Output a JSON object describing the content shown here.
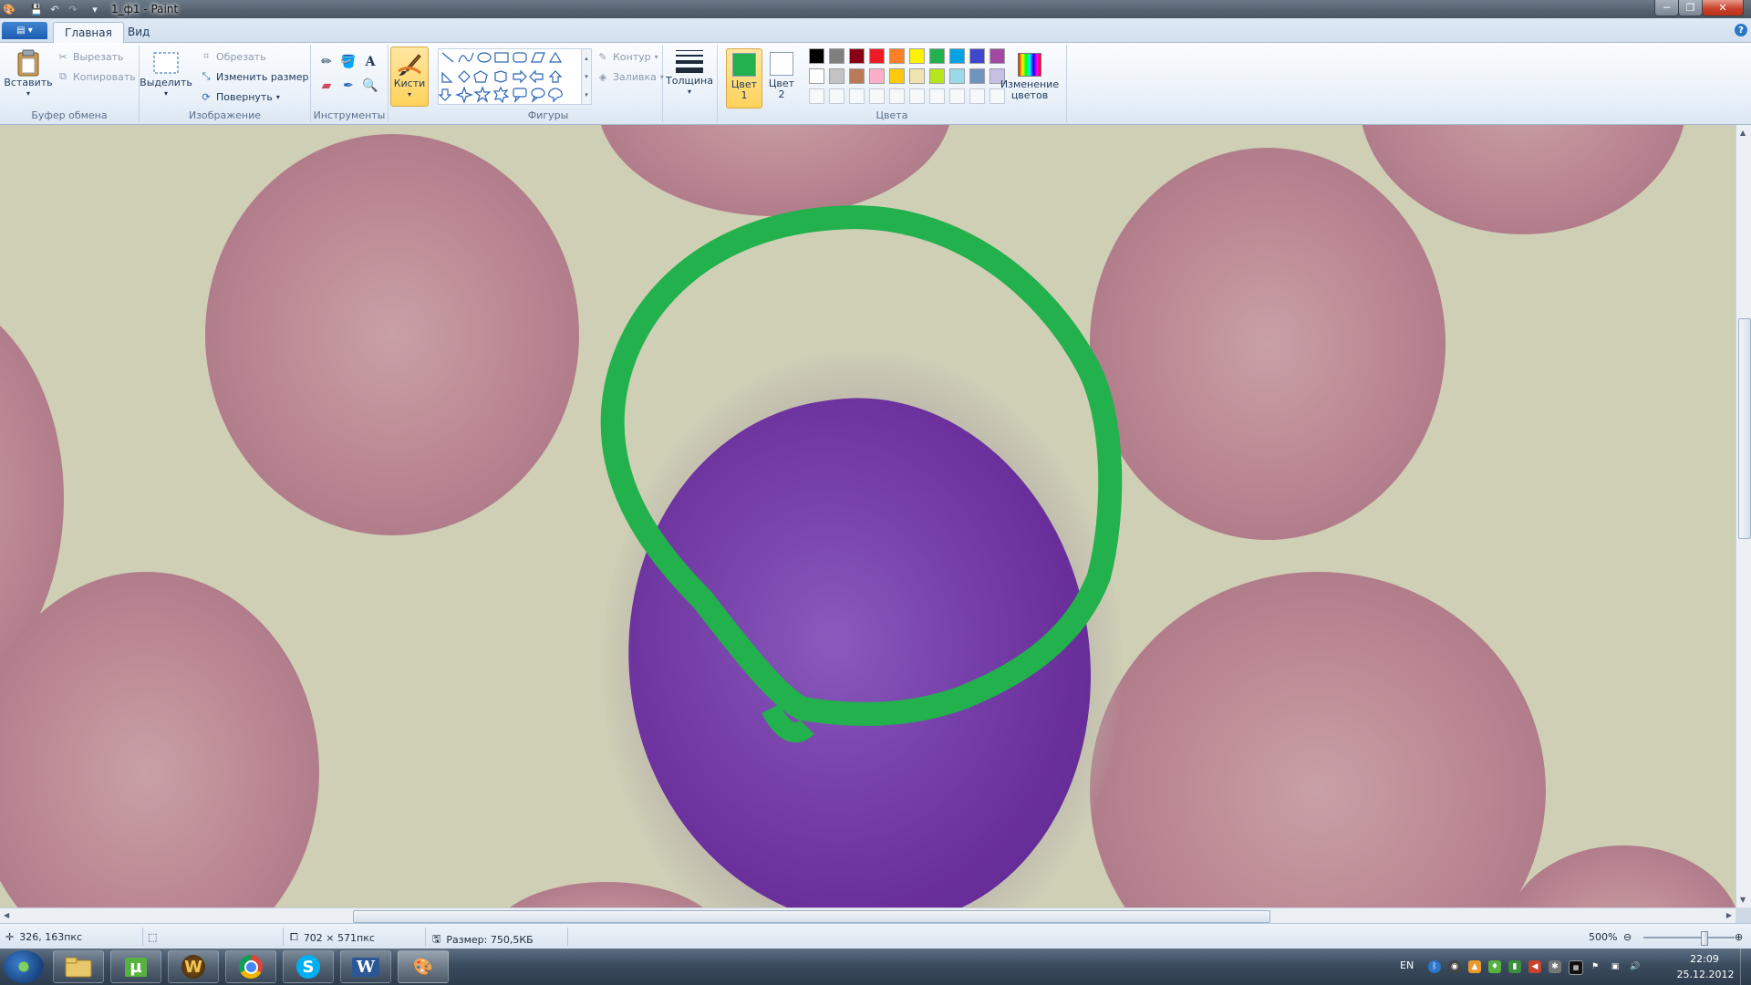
{
  "window": {
    "title": "1_ф1 - Paint"
  },
  "tabs": [
    {
      "label": "Главная"
    },
    {
      "label": "Вид"
    }
  ],
  "ribbon": {
    "clipboard": {
      "group": "Буфер обмена",
      "paste": "Вставить",
      "cut": "Вырезать",
      "copy": "Копировать"
    },
    "image": {
      "group": "Изображение",
      "select": "Выделить",
      "crop": "Обрезать",
      "resize": "Изменить размер",
      "rotate": "Повернуть"
    },
    "tools": {
      "group": "Инструменты"
    },
    "brushes": {
      "label": "Кисти"
    },
    "shapes": {
      "group": "Фигуры",
      "outline": "Контур",
      "fill": "Заливка"
    },
    "size": {
      "label": "Толщина"
    },
    "colors": {
      "group": "Цвета",
      "color1": "Цвет 1",
      "color2": "Цвет 2",
      "edit": "Изменение цветов",
      "color1_value": "#22b14c",
      "color2_value": "#ffffff",
      "palette_row1": [
        "#000000",
        "#7f7f7f",
        "#880015",
        "#ed1c24",
        "#ff7f27",
        "#fff200",
        "#22b14c",
        "#00a2e8",
        "#3f48cc",
        "#a349a4"
      ],
      "palette_row2": [
        "#ffffff",
        "#c3c3c3",
        "#b97a57",
        "#ffaec9",
        "#ffc90e",
        "#efe4b0",
        "#b5e61d",
        "#99d9ea",
        "#7092be",
        "#c8bfe7"
      ]
    }
  },
  "status": {
    "cursor": "326, 163пкс",
    "dimensions": "702 × 571пкс",
    "filesize": "Размер: 750,5КБ",
    "zoom": "500%"
  },
  "taskbar": {
    "lang": "EN",
    "time": "22:09",
    "date": "25.12.2012"
  }
}
